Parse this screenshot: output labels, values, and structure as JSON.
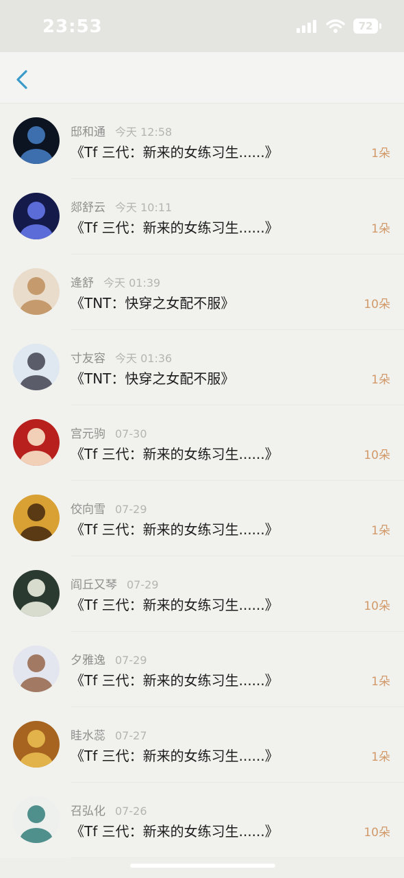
{
  "status_bar": {
    "time": "23:53",
    "battery": "72"
  },
  "nav": {
    "back_icon": "chevron-left-icon",
    "accent_color": "#3a9ac9"
  },
  "rows": [
    {
      "name": "邸和通",
      "time": "今天 12:58",
      "title": "《Tf 三代：新来的女练习生......》",
      "count": "1朵",
      "avatar": {
        "bg": "#0b1420",
        "fg": "#3d6fae"
      }
    },
    {
      "name": "郯舒云",
      "time": "今天 10:11",
      "title": "《Tf 三代：新来的女练习生......》",
      "count": "1朵",
      "avatar": {
        "bg": "#141a4a",
        "fg": "#5b6bd8"
      }
    },
    {
      "name": "逄舒",
      "time": "今天 01:39",
      "title": "《TNT：快穿之女配不服》",
      "count": "10朵",
      "avatar": {
        "bg": "#e9dccb",
        "fg": "#c59a6d"
      }
    },
    {
      "name": "寸友容",
      "time": "今天 01:36",
      "title": "《TNT：快穿之女配不服》",
      "count": "1朵",
      "avatar": {
        "bg": "#dfe8f0",
        "fg": "#5a5c6a"
      }
    },
    {
      "name": "宫元驹",
      "time": "07-30",
      "title": "《Tf 三代：新来的女练习生......》",
      "count": "10朵",
      "avatar": {
        "bg": "#b8201e",
        "fg": "#f2d0b8"
      }
    },
    {
      "name": "佼向雪",
      "time": "07-29",
      "title": "《Tf 三代：新来的女练习生......》",
      "count": "1朵",
      "avatar": {
        "bg": "#d9a133",
        "fg": "#5a3a14"
      }
    },
    {
      "name": "阎丘又琴",
      "time": "07-29",
      "title": "《Tf 三代：新来的女练习生......》",
      "count": "10朵",
      "avatar": {
        "bg": "#2b3a30",
        "fg": "#d7dccf"
      }
    },
    {
      "name": "夕雅逸",
      "time": "07-29",
      "title": "《Tf 三代：新来的女练习生......》",
      "count": "1朵",
      "avatar": {
        "bg": "#e3e6ee",
        "fg": "#a27a64"
      }
    },
    {
      "name": "眭水蕊",
      "time": "07-27",
      "title": "《Tf 三代：新来的女练习生......》",
      "count": "1朵",
      "avatar": {
        "bg": "#a66420",
        "fg": "#e2b34a"
      }
    },
    {
      "name": "召弘化",
      "time": "07-26",
      "title": "《Tf 三代：新来的女练习生......》",
      "count": "10朵",
      "avatar": {
        "bg": "#eef0ee",
        "fg": "#4f8f8c"
      }
    }
  ]
}
